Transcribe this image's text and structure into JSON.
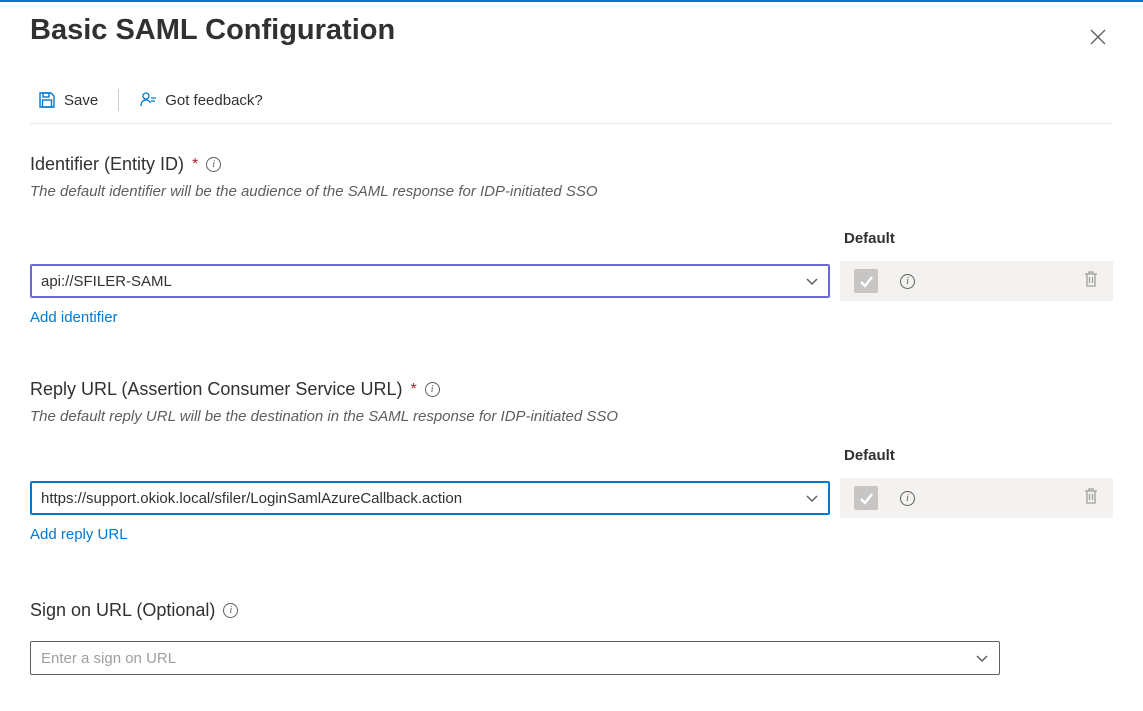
{
  "header": {
    "title": "Basic SAML Configuration"
  },
  "toolbar": {
    "save_label": "Save",
    "feedback_label": "Got feedback?"
  },
  "identifier": {
    "label": "Identifier (Entity ID)",
    "description": "The default identifier will be the audience of the SAML response for IDP-initiated SSO",
    "default_col": "Default",
    "value": "api://SFILER-SAML",
    "add_link": "Add identifier"
  },
  "reply": {
    "label": "Reply URL (Assertion Consumer Service URL)",
    "description": "The default reply URL will be the destination in the SAML response for IDP-initiated SSO",
    "default_col": "Default",
    "value": "https://support.okiok.local/sfiler/LoginSamlAzureCallback.action",
    "add_link": "Add reply URL"
  },
  "signon": {
    "label": "Sign on URL (Optional)",
    "placeholder": "Enter a sign on URL"
  }
}
